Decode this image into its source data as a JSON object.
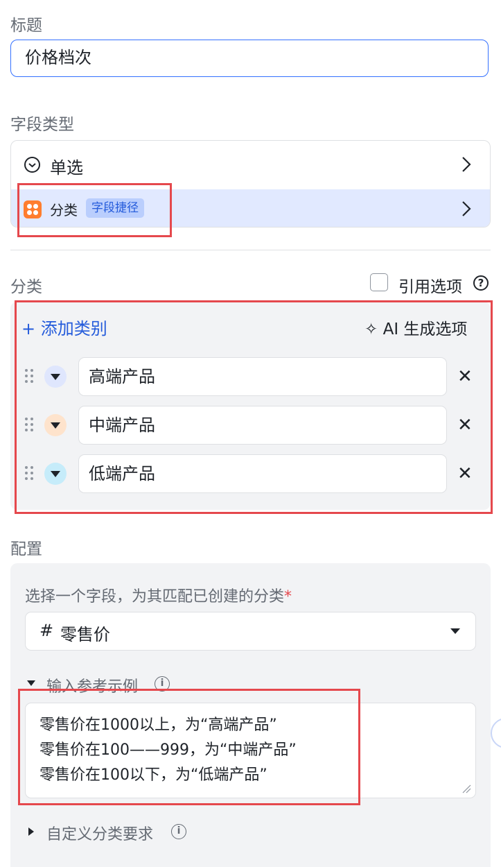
{
  "title_field": {
    "label": "标题",
    "value": "价格档次"
  },
  "field_type": {
    "label": "字段类型",
    "type_name": "单选",
    "shortcut_name": "分类",
    "shortcut_badge": "字段捷径"
  },
  "categories": {
    "label": "分类",
    "reference_label": "引用选项",
    "help_symbol": "?",
    "add_label": "添加类别",
    "add_symbol": "+",
    "ai_label": "AI 生成选项",
    "ai_symbol": "✧",
    "items": [
      {
        "value": "高端产品",
        "color": "#dfe6fd"
      },
      {
        "value": "中端产品",
        "color": "#fee3cc"
      },
      {
        "value": "低端产品",
        "color": "#c6ecfa"
      }
    ],
    "remove_symbol": "✕"
  },
  "config": {
    "label": "配置",
    "select_label": "选择一个字段，为其匹配已创建的分类",
    "required_mark": "*",
    "field_icon": "#",
    "field_value": "零售价",
    "examples_label": "输入参考示例",
    "examples_text": "零售价在1000以上，为“高端产品”\n零售价在100——999，为“中端产品”\n零售价在100以下，为“低端产品”",
    "custom_label": "自定义分类要求",
    "info_symbol": "i"
  },
  "colors": {
    "accent": "#245bdb",
    "highlight": "#e5484d",
    "shortcut_bg": "#e1e9ff"
  }
}
